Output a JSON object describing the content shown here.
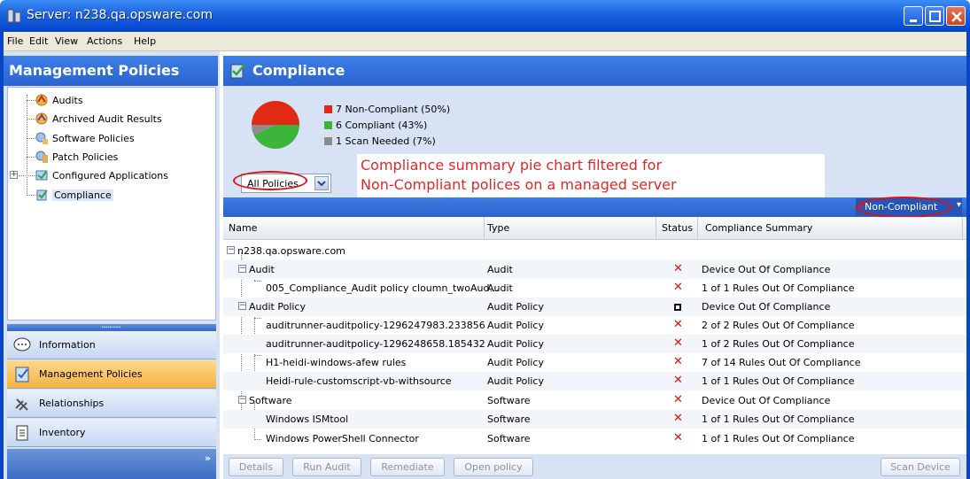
{
  "window": {
    "title": "Server: n238.qa.opsware.com"
  },
  "menu": [
    "File",
    "Edit",
    "View",
    "Actions",
    "Help"
  ],
  "left": {
    "header": "Management Policies",
    "tree": [
      {
        "label": "Audits",
        "icon": "audit-icon"
      },
      {
        "label": "Archived Audit Results",
        "icon": "archived-audit-icon"
      },
      {
        "label": "Software Policies",
        "icon": "software-policy-icon"
      },
      {
        "label": "Patch Policies",
        "icon": "patch-policy-icon"
      },
      {
        "label": "Configured Applications",
        "icon": "configured-apps-icon"
      },
      {
        "label": "Compliance",
        "icon": "compliance-icon"
      }
    ],
    "splitter": "..........",
    "nav": [
      {
        "label": "Information",
        "icon": "info-icon"
      },
      {
        "label": "Management Policies",
        "icon": "management-policies-icon"
      },
      {
        "label": "Relationships",
        "icon": "relationships-icon"
      },
      {
        "label": "Inventory",
        "icon": "inventory-icon"
      }
    ],
    "footer_glyph": "»"
  },
  "right": {
    "header": "Compliance",
    "legend": [
      {
        "label": "7 Non-Compliant (50%)",
        "color": "#e02a13",
        "value": 7
      },
      {
        "label": "6 Compliant (43%)",
        "color": "#3bb53a",
        "value": 6
      },
      {
        "label": "1 Scan Needed (7%)",
        "color": "#8c8c8c",
        "value": 1
      }
    ],
    "policy_filter": "All Policies",
    "annotation_line1": "Compliance summary pie chart filtered for",
    "annotation_line2": "Non-Compliant polices on a managed server",
    "status_filter": "Non-Compliant"
  },
  "table": {
    "columns": [
      "Name",
      "Type",
      "Status",
      "Compliance Summary"
    ],
    "root": "n238.qa.opsware.com",
    "rows": [
      {
        "name": "Audit",
        "type": "Audit",
        "status": "x",
        "summary": "Device Out Of Compliance"
      },
      {
        "name": "005_Compliance_Audit policy cloumn_twoAud...",
        "type": "Audit",
        "status": "x",
        "summary": "1 of 1 Rules Out Of Compliance"
      },
      {
        "name": "Audit Policy",
        "type": "Audit Policy",
        "status": "box",
        "summary": "Device Out Of Compliance"
      },
      {
        "name": "auditrunner-auditpolicy-1296247983.233856",
        "type": "Audit Policy",
        "status": "x",
        "summary": "2 of 2 Rules Out Of Compliance"
      },
      {
        "name": "auditrunner-auditpolicy-1296248658.185432",
        "type": "Audit Policy",
        "status": "x",
        "summary": "1 of 2 Rules Out Of Compliance"
      },
      {
        "name": "H1-heidi-windows-afew rules",
        "type": "Audit Policy",
        "status": "x",
        "summary": "7 of 14 Rules Out Of Compliance"
      },
      {
        "name": "Heidi-rule-customscript-vb-withsource",
        "type": "Audit Policy",
        "status": "x",
        "summary": "1 of 1 Rules Out Of Compliance"
      },
      {
        "name": "Software",
        "type": "Software",
        "status": "x",
        "summary": "Device Out Of Compliance"
      },
      {
        "name": "Windows ISMtool",
        "type": "Software",
        "status": "x",
        "summary": "1 of 1 Rules Out Of Compliance"
      },
      {
        "name": "Windows PowerShell Connector",
        "type": "Software",
        "status": "x",
        "summary": "1 of 1 Rules Out Of Compliance"
      }
    ],
    "status_x_glyph": "✕"
  },
  "buttons": {
    "details": "Details",
    "run_audit": "Run Audit",
    "remediate": "Remediate",
    "open_policy": "Open policy",
    "scan_device": "Scan Device"
  },
  "icons": {
    "expand_minus": "−",
    "expand_plus": "+",
    "dropdown_arrow": "▾",
    "close_x": "✕"
  }
}
